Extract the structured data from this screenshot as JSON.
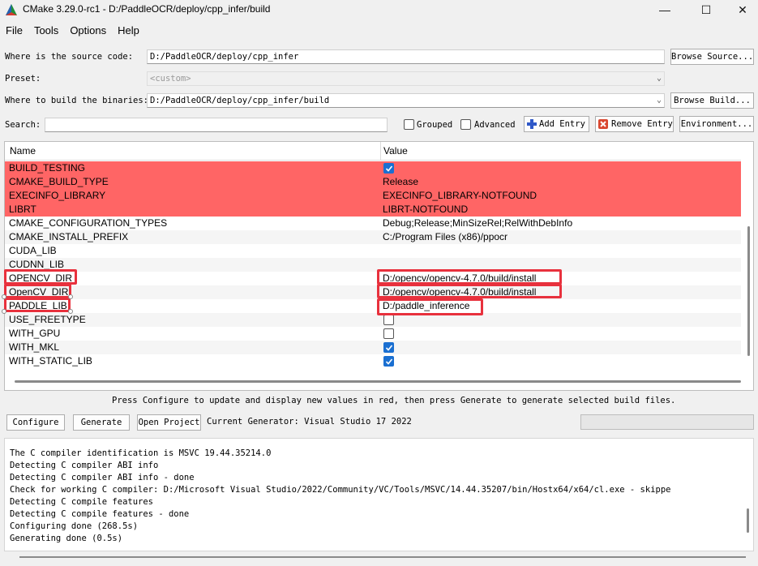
{
  "window": {
    "title": "CMake 3.29.0-rc1 - D:/PaddleOCR/deploy/cpp_infer/build",
    "minimize": "—",
    "maximize": "☐",
    "close": "✕"
  },
  "menu": [
    "File",
    "Tools",
    "Options",
    "Help"
  ],
  "form": {
    "source_label": "Where is the source code:",
    "source_value": "D:/PaddleOCR/deploy/cpp_infer",
    "browse_source": "Browse Source...",
    "preset_label": "Preset:",
    "preset_value": "<custom>",
    "build_label": "Where to build the binaries:",
    "build_value": "D:/PaddleOCR/deploy/cpp_infer/build",
    "browse_build": "Browse Build...",
    "search_label": "Search:",
    "search_value": "",
    "grouped_label": "Grouped",
    "advanced_label": "Advanced",
    "add_entry": "Add Entry",
    "remove_entry": "Remove Entry",
    "environment": "Environment..."
  },
  "table": {
    "col_name": "Name",
    "col_value": "Value",
    "rows": [
      {
        "name": "BUILD_TESTING",
        "value": "",
        "kind": "check",
        "checked": true,
        "new": true
      },
      {
        "name": "CMAKE_BUILD_TYPE",
        "value": "Release",
        "kind": "text",
        "new": true
      },
      {
        "name": "EXECINFO_LIBRARY",
        "value": "EXECINFO_LIBRARY-NOTFOUND",
        "kind": "text",
        "new": true
      },
      {
        "name": "LIBRT",
        "value": "LIBRT-NOTFOUND",
        "kind": "text",
        "new": true
      },
      {
        "name": "CMAKE_CONFIGURATION_TYPES",
        "value": "Debug;Release;MinSizeRel;RelWithDebInfo",
        "kind": "text",
        "new": false
      },
      {
        "name": "CMAKE_INSTALL_PREFIX",
        "value": "C:/Program Files (x86)/ppocr",
        "kind": "text",
        "new": false
      },
      {
        "name": "CUDA_LIB",
        "value": "",
        "kind": "text",
        "new": false
      },
      {
        "name": "CUDNN_LIB",
        "value": "",
        "kind": "text",
        "new": false
      },
      {
        "name": "OPENCV_DIR",
        "value": "D:/opencv/opencv-4.7.0/build/install",
        "kind": "text",
        "new": false
      },
      {
        "name": "OpenCV_DIR",
        "value": "D:/opencv/opencv-4.7.0/build/install",
        "kind": "text",
        "new": false
      },
      {
        "name": "PADDLE_LIB",
        "value": "D:/paddle_inference",
        "kind": "text",
        "new": false
      },
      {
        "name": "USE_FREETYPE",
        "value": "",
        "kind": "check",
        "checked": false,
        "new": false
      },
      {
        "name": "WITH_GPU",
        "value": "",
        "kind": "check",
        "checked": false,
        "new": false
      },
      {
        "name": "WITH_MKL",
        "value": "",
        "kind": "check",
        "checked": true,
        "new": false
      },
      {
        "name": "WITH_STATIC_LIB",
        "value": "",
        "kind": "check",
        "checked": true,
        "new": false
      }
    ]
  },
  "hint": "Press Configure to update and display new values in red, then press Generate to generate selected build files.",
  "actions": {
    "configure": "Configure",
    "generate": "Generate",
    "open_project": "Open Project",
    "current_generator": "Current Generator: Visual Studio 17 2022"
  },
  "log": [
    "The C compiler identification is MSVC 19.44.35214.0",
    "Detecting C compiler ABI info",
    "Detecting C compiler ABI info - done",
    "Check for working C compiler: D:/Microsoft Visual Studio/2022/Community/VC/Tools/MSVC/14.44.35207/bin/Hostx64/x64/cl.exe - skippe",
    "Detecting C compile features",
    "Detecting C compile features - done",
    "Configuring done (268.5s)",
    "Generating done (0.5s)"
  ],
  "colors": {
    "new_row": "#ff6565",
    "annotation": "#e8313d",
    "check_on": "#1a6fd1"
  }
}
